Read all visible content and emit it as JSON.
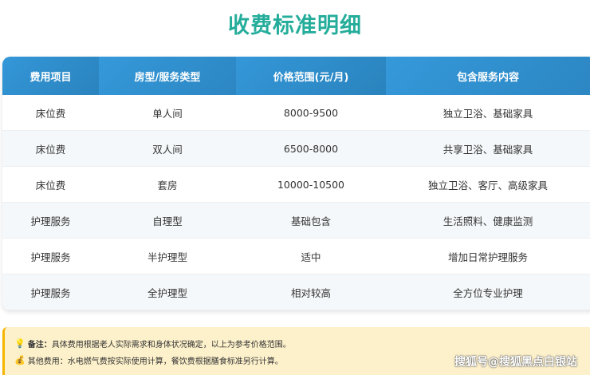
{
  "title": "收费标准明细",
  "headers": [
    "费用项目",
    "房型/服务类型",
    "价格范围(元/月)",
    "包含服务内容"
  ],
  "rows": [
    [
      "床位费",
      "单人间",
      "8000-9500",
      "独立卫浴、基础家具"
    ],
    [
      "床位费",
      "双人间",
      "6500-8000",
      "共享卫浴、基础家具"
    ],
    [
      "床位费",
      "套房",
      "10000-10500",
      "独立卫浴、客厅、高级家具"
    ],
    [
      "护理服务",
      "自理型",
      "基础包含",
      "生活照料、健康监测"
    ],
    [
      "护理服务",
      "半护理型",
      "适中",
      "增加日常护理服务"
    ],
    [
      "护理服务",
      "全护理型",
      "相对较高",
      "全方位专业护理"
    ]
  ],
  "notes": {
    "remark_label": "备注：",
    "remark": "具体费用根据老人实际需求和身体状况确定，以上为参考价格范围。",
    "other": "其他费用：水电燃气费按实际使用计算，餐饮费根据膳食标准另行计算。"
  },
  "watermark": "搜狐号@搜狐黑点白银站"
}
